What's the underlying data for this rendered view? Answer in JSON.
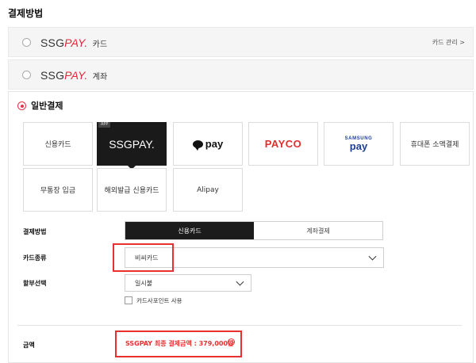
{
  "section_title": "결제방법",
  "ssgpay_card": {
    "brand_ssg": "SSG",
    "brand_pay": "PAY.",
    "suffix": "카드",
    "manage_label": "카드 관리 >"
  },
  "ssgpay_account": {
    "brand_ssg": "SSG",
    "brand_pay": "PAY.",
    "suffix": "계좌"
  },
  "general": {
    "label": "일반결제",
    "tiles": {
      "credit_card": "신용카드",
      "ssgpay_logo": "SSGPAY.",
      "app_badge": "APP",
      "kakao_pay": "pay",
      "payco": "PAYCO",
      "samsung_top": "SAMSUNG",
      "samsung_bottom": "pay",
      "phone_payment": "휴대폰 소액결제",
      "bank_transfer": "무통장 입금",
      "overseas_card": "해외발급 신용카드",
      "alipay": "Alipay"
    }
  },
  "form": {
    "method_label": "결제방법",
    "method_options": [
      "신용카드",
      "계좌결제"
    ],
    "card_type_label": "카드종류",
    "card_type_value": "비씨카드",
    "installment_label": "할부선택",
    "installment_value": "일시불",
    "point_checkbox_label": "카드사포인트 사용",
    "amount_label": "금액",
    "amount_text": "SSGPAY 최종 결제금액 : 379,000원"
  },
  "colors": {
    "accent_red": "#e7302f",
    "selected_dark": "#1a1a1a",
    "samsung_blue": "#1c3e98"
  }
}
